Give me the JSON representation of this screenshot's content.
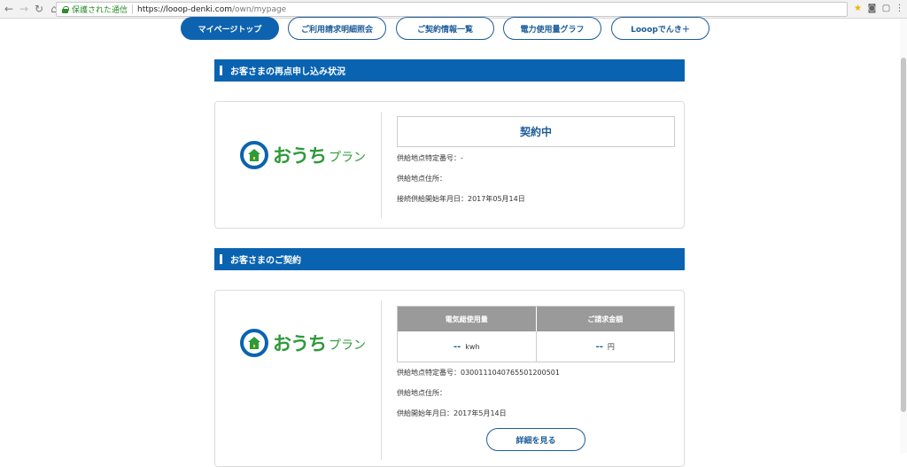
{
  "browser": {
    "secure_label": "保護された通信",
    "url_host": "https://looop-denki.com",
    "url_path": "/own/mypage"
  },
  "tabs": [
    {
      "label": "マイページトップ",
      "active": true
    },
    {
      "label": "ご利用請求明細照会",
      "active": false
    },
    {
      "label": "ご契約情報一覧",
      "active": false
    },
    {
      "label": "電力使用量グラフ",
      "active": false
    },
    {
      "label": "Looopでんき＋",
      "active": false
    }
  ],
  "section1": {
    "title": "お客さまの再点申し込み状況",
    "logo_main": "おうち",
    "logo_sub": "プラン",
    "status": "契約中",
    "supply_id": "供給地点特定番号：-",
    "supply_address": "供給地点住所：",
    "connect_start": "接続供給開始年月日：2017年05月14日"
  },
  "section2": {
    "title": "お客さまのご契約",
    "logo_main": "おうち",
    "logo_sub": "プラン",
    "col_usage": "電気総使用量",
    "col_bill": "ご請求金額",
    "usage_value": "--",
    "usage_unit": "kwh",
    "bill_value": "--",
    "bill_unit": "円",
    "supply_id": "供給地点特定番号：0300111040765501200501",
    "supply_address": "供給地点住所：",
    "supply_start": "供給開始年月日：2017年5月14日",
    "detail_button": "詳細を見る"
  },
  "colors": {
    "primary_blue": "#0a63b0",
    "brand_green": "#2e9a3a",
    "header_gray": "#9a9a9a"
  }
}
